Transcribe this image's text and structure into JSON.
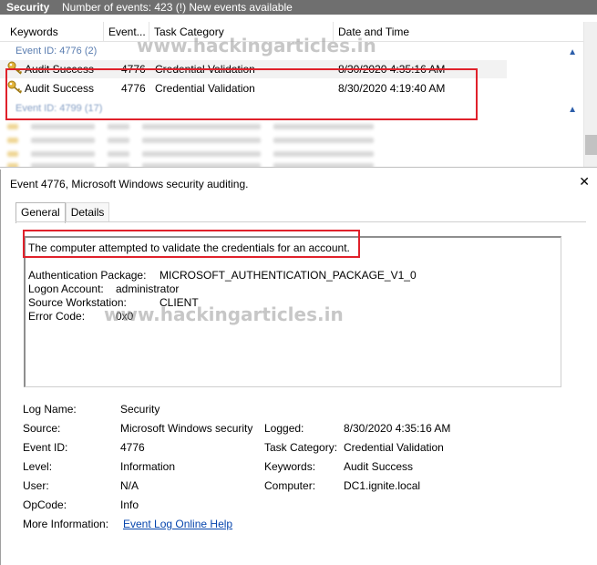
{
  "header": {
    "title": "Security",
    "count_text": "Number of events: 423 (!) New events available"
  },
  "columns": {
    "keywords": "Keywords",
    "event": "Event...",
    "task_category": "Task Category",
    "date_time": "Date and Time"
  },
  "groups": {
    "g1": "Event ID: 4776 (2)",
    "g2": "Event ID: 4799 (17)"
  },
  "rows": [
    {
      "keywords": "Audit Success",
      "event_id": "4776",
      "task_category": "Credential Validation",
      "date_time": "8/30/2020 4:35:16 AM"
    },
    {
      "keywords": "Audit Success",
      "event_id": "4776",
      "task_category": "Credential Validation",
      "date_time": "8/30/2020 4:19:40 AM"
    }
  ],
  "watermark": "www.hackingarticles.in",
  "details": {
    "title": "Event 4776, Microsoft Windows security auditing.",
    "close": "✕",
    "tabs": {
      "general": "General",
      "details": "Details"
    },
    "message": {
      "line1": "The computer attempted to validate the credentials for an account.",
      "auth_pkg_label": "Authentication Package:",
      "auth_pkg_value": "MICROSOFT_AUTHENTICATION_PACKAGE_V1_0",
      "logon_label": "Logon Account:",
      "logon_value": "administrator",
      "ws_label": "Source Workstation:",
      "ws_value": "CLIENT",
      "err_label": "Error Code:",
      "err_value": "0x0"
    },
    "props": {
      "log_name_label": "Log Name:",
      "log_name": "Security",
      "source_label": "Source:",
      "source": "Microsoft Windows security",
      "logged_label": "Logged:",
      "logged": "8/30/2020 4:35:16 AM",
      "event_id_label": "Event ID:",
      "event_id": "4776",
      "task_cat_label": "Task Category:",
      "task_cat": "Credential Validation",
      "level_label": "Level:",
      "level": "Information",
      "keywords_label": "Keywords:",
      "keywords": "Audit Success",
      "user_label": "User:",
      "user": "N/A",
      "computer_label": "Computer:",
      "computer": "DC1.ignite.local",
      "opcode_label": "OpCode:",
      "opcode": "Info",
      "more_info_label": "More Information:",
      "more_info_link": "Event Log Online Help"
    }
  },
  "colors": {
    "header_bg": "#6f6f6f",
    "highlight": "#e0212b",
    "link": "#0645ad",
    "group_text": "#5a7db0"
  }
}
